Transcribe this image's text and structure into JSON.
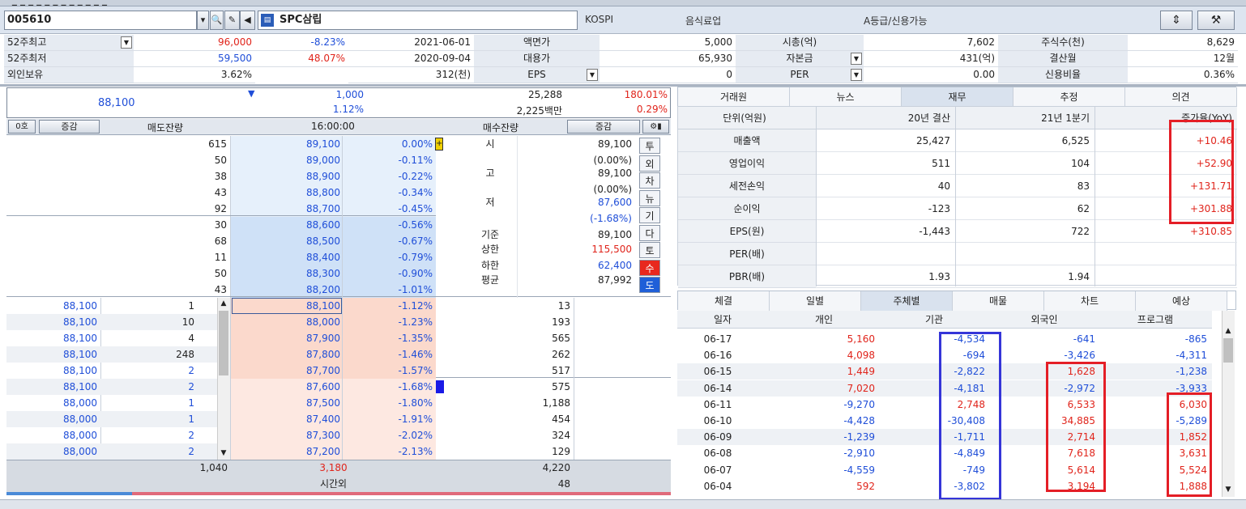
{
  "colors": {
    "red": "#e0241b",
    "blue": "#1f4ed8",
    "highlight_red": "#e41e26",
    "highlight_blue": "#3535d8"
  },
  "header": {
    "code": "005610",
    "name": "SPC삼립",
    "market": "KOSPI",
    "sector": "음식료업",
    "grade": "A등급/신용가능",
    "icons": [
      "dropdown-icon",
      "search-icon",
      "wrench-icon",
      "speaker-icon",
      "chart-icon",
      "swap-icon",
      "tools-icon"
    ]
  },
  "info": {
    "row1": {
      "label": "52주최고",
      "price": "96,000",
      "pct": "-8.23%",
      "date": "2021-06-01",
      "l2": "액면가",
      "v2": "5,000",
      "l3": "시총(억)",
      "v3": "7,602",
      "l4": "주식수(천)",
      "v4": "8,629"
    },
    "row2": {
      "label": "52주최저",
      "price": "59,500",
      "pct": "48.07%",
      "date": "2020-09-04",
      "l2": "대용가",
      "v2": "65,930",
      "l3": "자본금",
      "v3": "431(억)",
      "l4": "결산월",
      "v4": "12월"
    },
    "row3": {
      "label": "외인보유",
      "price": "3.62%",
      "date": "312(천)",
      "l2": "EPS",
      "v2": "0",
      "l3": "PER",
      "v3": "0.00",
      "l4": "신용비율",
      "v4": "0.36%"
    }
  },
  "quote": {
    "price": "88,100",
    "change": "1,000",
    "change_pct": "1.12%",
    "volume": "25,288",
    "amount": "2,225백만",
    "vol_ratio": "180.01%",
    "turnover": "0.29%"
  },
  "orderbook": {
    "head": {
      "toggle": "0호",
      "chg1": "증감",
      "ask_rem": "매도잔량",
      "time": "16:00:00",
      "bid_rem": "매수잔량",
      "chg2": "증감"
    },
    "asks": [
      {
        "q": "615",
        "p": "89,100",
        "r": "0.00%"
      },
      {
        "q": "50",
        "p": "89,000",
        "r": "-0.11%"
      },
      {
        "q": "38",
        "p": "88,900",
        "r": "-0.22%"
      },
      {
        "q": "43",
        "p": "88,800",
        "r": "-0.34%"
      },
      {
        "q": "92",
        "p": "88,700",
        "r": "-0.45%"
      },
      {
        "q": "30",
        "p": "88,600",
        "r": "-0.56%"
      },
      {
        "q": "68",
        "p": "88,500",
        "r": "-0.67%"
      },
      {
        "q": "11",
        "p": "88,400",
        "r": "-0.79%"
      },
      {
        "q": "50",
        "p": "88,300",
        "r": "-0.90%"
      },
      {
        "q": "43",
        "p": "88,200",
        "r": "-1.01%"
      }
    ],
    "bids": [
      {
        "p": "88,100",
        "r": "-1.12%",
        "q": "13"
      },
      {
        "p": "88,000",
        "r": "-1.23%",
        "q": "193"
      },
      {
        "p": "87,900",
        "r": "-1.35%",
        "q": "565"
      },
      {
        "p": "87,800",
        "r": "-1.46%",
        "q": "262"
      },
      {
        "p": "87,700",
        "r": "-1.57%",
        "q": "517"
      },
      {
        "p": "87,600",
        "r": "-1.68%",
        "q": "575"
      },
      {
        "p": "87,500",
        "r": "-1.80%",
        "q": "1,188"
      },
      {
        "p": "87,400",
        "r": "-1.91%",
        "q": "454"
      },
      {
        "p": "87,300",
        "r": "-2.02%",
        "q": "324"
      },
      {
        "p": "87,200",
        "r": "-2.13%",
        "q": "129"
      }
    ],
    "ticks": [
      {
        "p": "88,100",
        "q": "1"
      },
      {
        "p": "88,100",
        "q": "10"
      },
      {
        "p": "88,100",
        "q": "4"
      },
      {
        "p": "88,100",
        "q": "248"
      },
      {
        "p": "88,100",
        "q": "2"
      },
      {
        "p": "88,100",
        "q": "2"
      },
      {
        "p": "88,000",
        "q": "1"
      },
      {
        "p": "88,000",
        "q": "1"
      },
      {
        "p": "88,000",
        "q": "2"
      },
      {
        "p": "88,000",
        "q": "2"
      }
    ],
    "stats": [
      {
        "label": "시",
        "value": "89,100"
      },
      {
        "label": "",
        "value": "(0.00%)"
      },
      {
        "label": "고",
        "value": "89,100"
      },
      {
        "label": "",
        "value": "(0.00%)"
      },
      {
        "label": "저",
        "value": "87,600"
      },
      {
        "label": "",
        "value": "(-1.68%)"
      },
      {
        "label": "기준",
        "value": "89,100"
      },
      {
        "label": "상한",
        "value": "115,500"
      },
      {
        "label": "하한",
        "value": "62,400"
      },
      {
        "label": "평균",
        "value": "87,992"
      }
    ],
    "side_buttons": [
      "투",
      "외",
      "차",
      "뉴",
      "기",
      "다",
      "토",
      "수",
      "도"
    ],
    "totals": {
      "ask": "1,040",
      "diff": "3,180",
      "bid": "4,220",
      "after_label": "시간외",
      "after": "48"
    }
  },
  "fin": {
    "tabs": [
      "거래원",
      "뉴스",
      "재무",
      "추정",
      "의견"
    ],
    "head": [
      "단위(억원)",
      "20년 결산",
      "21년 1분기",
      "증가율(YoY)"
    ],
    "rows": [
      {
        "l": "매출액",
        "a": "25,427",
        "b": "6,525",
        "c": "+10.46"
      },
      {
        "l": "영업이익",
        "a": "511",
        "b": "104",
        "c": "+52.90"
      },
      {
        "l": "세전손익",
        "a": "40",
        "b": "83",
        "c": "+131.71"
      },
      {
        "l": "순이익",
        "a": "-123",
        "b": "62",
        "c": "+301.88"
      },
      {
        "l": "EPS(원)",
        "a": "-1,443",
        "b": "722",
        "c": "+310.85"
      },
      {
        "l": "PER(배)",
        "a": "",
        "b": "",
        "c": ""
      },
      {
        "l": "PBR(배)",
        "a": "1.93",
        "b": "1.94",
        "c": ""
      }
    ]
  },
  "inv": {
    "tabs": [
      "체결",
      "일별",
      "주체별",
      "매물",
      "차트",
      "예상"
    ],
    "head": [
      "일자",
      "개인",
      "기관",
      "외국인",
      "프로그램"
    ],
    "rows": [
      {
        "d": "06-17",
        "a": "5,160",
        "b": "-4,534",
        "c": "-641",
        "e": "-865"
      },
      {
        "d": "06-16",
        "a": "4,098",
        "b": "-694",
        "c": "-3,426",
        "e": "-4,311"
      },
      {
        "d": "06-15",
        "a": "1,449",
        "b": "-2,822",
        "c": "1,628",
        "e": "-1,238"
      },
      {
        "d": "06-14",
        "a": "7,020",
        "b": "-4,181",
        "c": "-2,972",
        "e": "-3,933"
      },
      {
        "d": "06-11",
        "a": "-9,270",
        "b": "2,748",
        "c": "6,533",
        "e": "6,030"
      },
      {
        "d": "06-10",
        "a": "-4,428",
        "b": "-30,408",
        "c": "34,885",
        "e": "-5,289"
      },
      {
        "d": "06-09",
        "a": "-1,239",
        "b": "-1,711",
        "c": "2,714",
        "e": "1,852"
      },
      {
        "d": "06-08",
        "a": "-2,910",
        "b": "-4,849",
        "c": "7,618",
        "e": "3,631"
      },
      {
        "d": "06-07",
        "a": "-4,559",
        "b": "-749",
        "c": "5,614",
        "e": "5,524"
      },
      {
        "d": "06-04",
        "a": "592",
        "b": "-3,802",
        "c": "3,194",
        "e": "1,888"
      }
    ]
  }
}
